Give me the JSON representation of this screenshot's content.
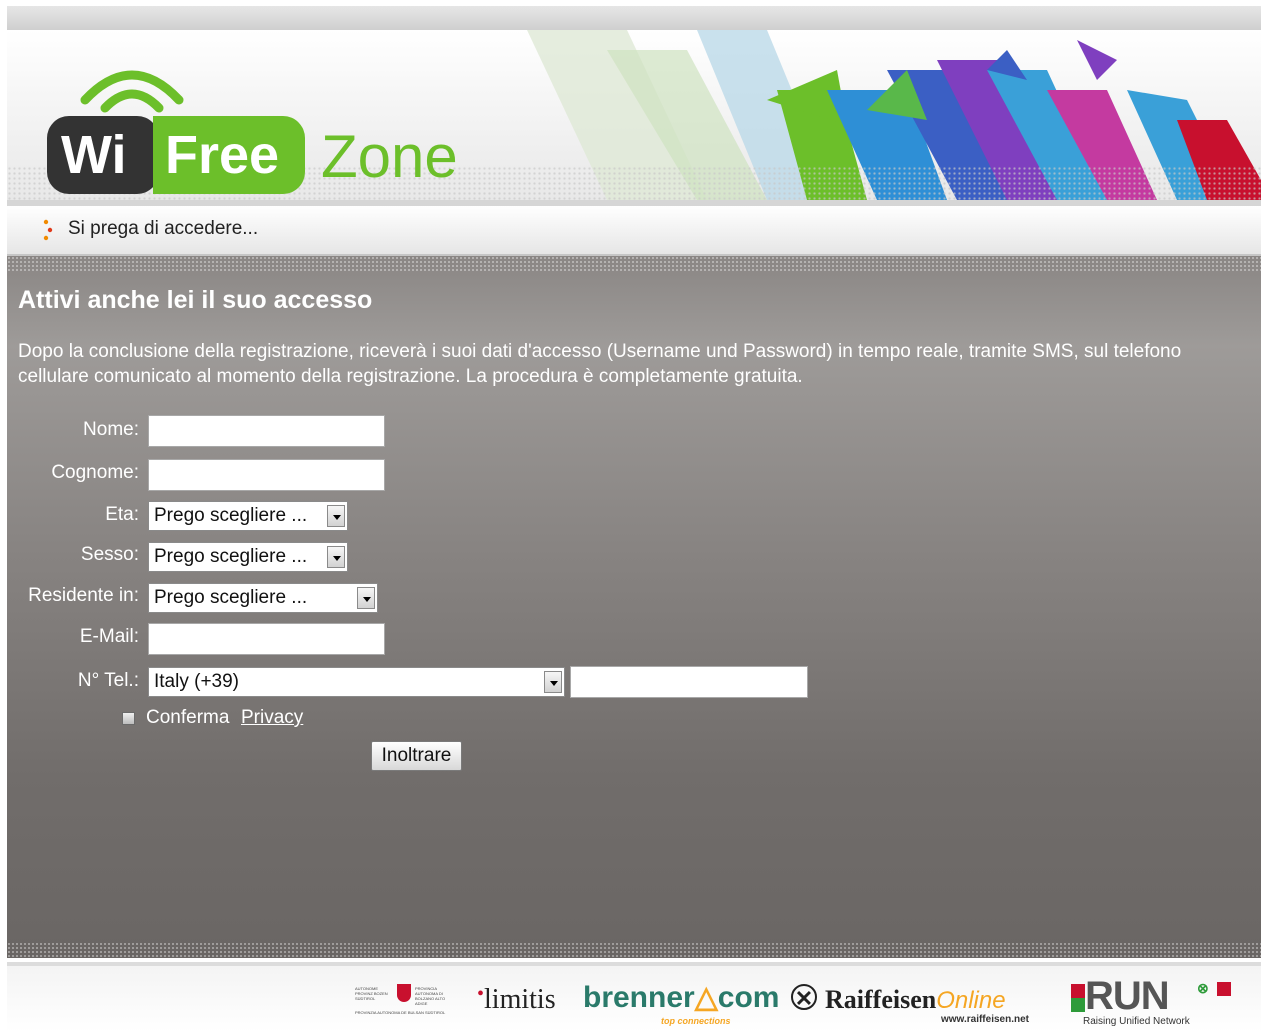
{
  "header": {
    "logo_wi": "Wi",
    "logo_free": "Free",
    "logo_zone": "Zone"
  },
  "notice": {
    "text": "Si prega di accedere..."
  },
  "main": {
    "title": "Attivi anche lei il suo accesso",
    "description": "Dopo la conclusione della registrazione, riceverà i suoi dati d'accesso (Username und Password) in tempo reale, tramite SMS, sul telefono cellulare comunicato al momento della registrazione. La procedura è completamente gratuita."
  },
  "form": {
    "nome_label": "Nome:",
    "nome_value": "",
    "cognome_label": "Cognome:",
    "cognome_value": "",
    "eta_label": "Eta:",
    "eta_selected": "Prego scegliere ...",
    "sesso_label": "Sesso:",
    "sesso_selected": "Prego scegliere ...",
    "residente_label": "Residente in:",
    "residente_selected": "Prego scegliere ...",
    "email_label": "E-Mail:",
    "email_value": "",
    "tel_label": "N° Tel.:",
    "tel_country_selected": "Italy (+39)",
    "tel_value": "",
    "privacy_checked": false,
    "privacy_text": "Conferma",
    "privacy_link": "Privacy",
    "submit_label": "Inoltrare"
  },
  "footer": {
    "sponsors": {
      "provincia": "Autonome Provinz Bozen Südtirol / Provincia Autonoma di Bolzano Alto Adige",
      "limitis": "limitis",
      "brenner_main": "brenner",
      "brenner_com": "com",
      "brenner_sub": "top connections",
      "raiffeisen": "Raiffeisen",
      "raiffeisen_online": "Online",
      "raiffeisen_www": "www.raiffeisen.net",
      "run": "RUN",
      "run_sub": "Raising Unified Network"
    }
  },
  "colors": {
    "brand_green": "#6cbf2a",
    "logo_dark": "#333333",
    "panel_gray": "#8a8684",
    "text_white": "#ffffff"
  }
}
